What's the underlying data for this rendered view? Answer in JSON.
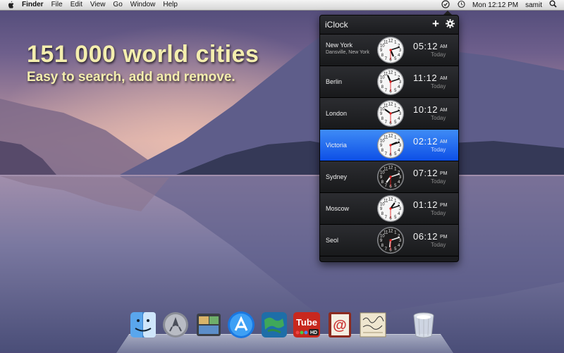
{
  "menubar": {
    "apple_icon": "apple-icon",
    "app_name": "Finder",
    "menus": [
      "File",
      "Edit",
      "View",
      "Go",
      "Window",
      "Help"
    ],
    "clock_text": "Mon 12:12 PM",
    "user": "samit",
    "status_icons": [
      "iclock-icon",
      "time-machine-icon",
      "spotlight-icon"
    ]
  },
  "headline": {
    "line1": "151 000 world cities",
    "line2": "Easy to search, add and remove."
  },
  "iclock": {
    "title": "iClock",
    "add_label": "+",
    "settings_icon": "gear-icon",
    "accent_selected": "#1d63f0",
    "rows": [
      {
        "city": "New York",
        "subtitle": "Dansville, New York",
        "time": "05:12",
        "ampm": "AM",
        "day": "Today",
        "hour": 5,
        "minute": 12,
        "night": false
      },
      {
        "city": "Berlin",
        "subtitle": "",
        "time": "11:12",
        "ampm": "AM",
        "day": "Today",
        "hour": 11,
        "minute": 12,
        "night": false
      },
      {
        "city": "London",
        "subtitle": "",
        "time": "10:12",
        "ampm": "AM",
        "day": "Today",
        "hour": 10,
        "minute": 12,
        "night": false
      },
      {
        "city": "Victoria",
        "subtitle": "",
        "time": "02:12",
        "ampm": "AM",
        "day": "Today",
        "hour": 2,
        "minute": 12,
        "night": false,
        "selected": true
      },
      {
        "city": "Sydney",
        "subtitle": "",
        "time": "07:12",
        "ampm": "PM",
        "day": "Today",
        "hour": 7,
        "minute": 12,
        "night": true
      },
      {
        "city": "Moscow",
        "subtitle": "",
        "time": "01:12",
        "ampm": "PM",
        "day": "Today",
        "hour": 1,
        "minute": 12,
        "night": false
      },
      {
        "city": "Seol",
        "subtitle": "",
        "time": "06:12",
        "ampm": "PM",
        "day": "Today",
        "hour": 6,
        "minute": 12,
        "night": true
      }
    ]
  },
  "dock": {
    "items": [
      {
        "name": "finder-icon"
      },
      {
        "name": "launchpad-icon"
      },
      {
        "name": "iphoto-icon"
      },
      {
        "name": "app-store-icon"
      },
      {
        "name": "world-map-icon"
      },
      {
        "name": "youtube-hd-icon",
        "label": "Tube",
        "badge": "HD"
      },
      {
        "name": "address-book-icon",
        "label": "@"
      },
      {
        "name": "signature-icon"
      },
      {
        "name": "trash-icon"
      }
    ]
  }
}
